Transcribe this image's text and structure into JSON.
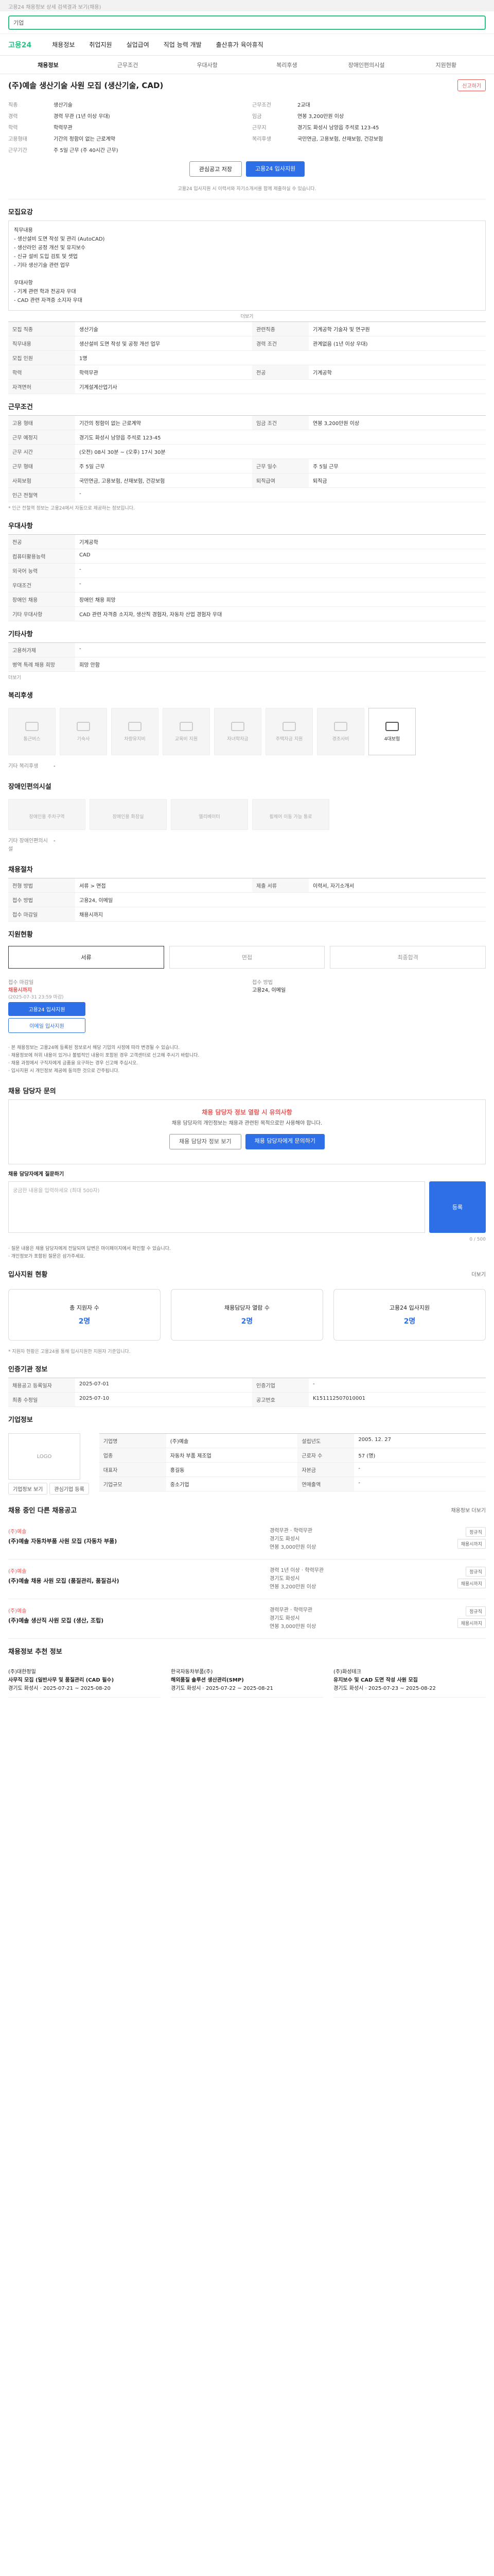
{
  "topbar": {
    "left": "고용24 채용정보 상세 검색결과 보기(채용)",
    "right": ""
  },
  "search": {
    "placeholder": "검색어를 입력하세요",
    "value": "기업"
  },
  "gnb": {
    "logo": "고용24",
    "items": [
      "채용정보",
      "취업지원",
      "실업급여",
      "직업 능력 개발",
      "출산휴가 육아휴직"
    ]
  },
  "tabs": [
    "채용정보",
    "근무조건",
    "우대사항",
    "복리후생",
    "장애인편의시설",
    "지원현황"
  ],
  "header": {
    "title": "(주)예솔 생산기술 사원 모집 (생산기술, CAD)",
    "badge": "채용공고",
    "report": "신고하기"
  },
  "summary": [
    {
      "k": "직종",
      "v": "생산기술"
    },
    {
      "k": "근무조건",
      "v": "2교대"
    },
    {
      "k": "경력",
      "v": "경력 무관 (1년 이상 우대)"
    },
    {
      "k": "임금",
      "v": "연봉 3,200만원 이상"
    },
    {
      "k": "학력",
      "v": "학력무관"
    },
    {
      "k": "근무지",
      "v": "경기도 화성시 남양읍 주석로 123-45"
    },
    {
      "k": "고용형태",
      "v": "기간의 정함이 없는 근로계약"
    },
    {
      "k": "복리후생",
      "v": "국민연금, 고용보험, 산재보험, 건강보험"
    },
    {
      "k": "근무기간",
      "v": "주 5일 근무 (주 40시간 근무)"
    }
  ],
  "buttons": {
    "save": "관심공고 저장",
    "apply": "고용24 입사지원"
  },
  "notice1": "고용24 입사지원 시 이력서와 자기소개서를 함께 제출하실 수 있습니다.",
  "recruit": {
    "title": "모집요강",
    "body": "직무내용\n- 생산설비 도면 작성 및 관리 (AutoCAD)\n- 생산라인 공정 개선 및 유지보수\n- 신규 설비 도입 검토 및 셋업\n- 기타 생산기술 관련 업무\n\n우대사항\n- 기계 관련 학과 전공자 우대\n- CAD 관련 자격증 소지자 우대",
    "more": "더보기",
    "rows": [
      {
        "k": "모집 직종",
        "v": "생산기술",
        "k2": "관련직종",
        "v2": "기계공학 기술자 및 연구원"
      },
      {
        "k": "직무내용",
        "v": "생산설비 도면 작성 및 공정 개선 업무",
        "k2": "경력 조건",
        "v2": "관계없음 (1년 이상 우대)"
      },
      {
        "k": "모집 인원",
        "v": "1명",
        "k2": "",
        "v2": ""
      },
      {
        "k": "학력",
        "v": "학력무관",
        "k2": "전공",
        "v2": "기계공학"
      },
      {
        "k": "자격면허",
        "v": "기계설계산업기사",
        "k2": "",
        "v2": ""
      }
    ]
  },
  "work": {
    "title": "근무조건",
    "rows": [
      {
        "k": "고용 형태",
        "v": "기간의 정함이 없는 근로계약",
        "k2": "임금 조건",
        "v2": "연봉 3,200만원 이상"
      },
      {
        "k": "근무 예정지",
        "v": "경기도 화성시 남양읍 주석로 123-45",
        "k2": "",
        "v2": ""
      },
      {
        "k": "근무 시간",
        "v": "(오전) 08시 30분 ~ (오후) 17시 30분",
        "k2": "",
        "v2": ""
      },
      {
        "k": "근무 형태",
        "v": "주 5일 근무",
        "k2": "근무 일수",
        "v2": "주 5일 근무"
      },
      {
        "k": "사회보험",
        "v": "국민연금, 고용보험, 산재보험, 건강보험",
        "k2": "퇴직급여",
        "v2": "퇴직금"
      },
      {
        "k": "인근 전철역",
        "v": "-",
        "k2": "",
        "v2": ""
      }
    ],
    "note": "* 인근 전철역 정보는 고용24에서 자동으로 제공하는 정보입니다."
  },
  "prefer": {
    "title": "우대사항",
    "rows": [
      {
        "k": "전공",
        "v": "기계공학"
      },
      {
        "k": "컴퓨터활용능력",
        "v": "CAD"
      },
      {
        "k": "외국어 능력",
        "v": "-"
      },
      {
        "k": "우대조건",
        "v": "-"
      },
      {
        "k": "장애인 채용",
        "v": "장애인 채용 희망"
      },
      {
        "k": "기타 우대사항",
        "v": "CAD 관련 자격증 소지자, 생산직 경험자, 자동차 산업 경험자 우대"
      }
    ]
  },
  "etc": {
    "title": "기타사항",
    "rows": [
      {
        "k": "고용허가제",
        "v": "-"
      },
      {
        "k": "병역 특례 채용 희망",
        "v": "희망 안함"
      }
    ],
    "more": "더보기"
  },
  "welfare": {
    "title": "복리후생",
    "items": [
      "통근버스",
      "기숙사",
      "차량유지비",
      "교육비 지원",
      "자녀학자금",
      "주택자금 지원",
      "경조사비",
      "4대보험"
    ],
    "active": "4대보험",
    "etc_label": "기타 복리후생",
    "etc_value": "-"
  },
  "facility": {
    "title": "장애인편의시설",
    "items": [
      "장애인용 주차구역",
      "장애인용 화장실",
      "엘리베이터",
      "휠체어 이동 가능 통로"
    ],
    "etc_label": "기타 장애인편의시설",
    "etc_value": "-"
  },
  "process": {
    "title": "채용절차",
    "rows": [
      {
        "k": "전형 방법",
        "v": "서류 > 면접",
        "k2": "제출 서류",
        "v2": "이력서, 자기소개서"
      },
      {
        "k": "접수 방법",
        "v": "고용24, 이메일",
        "k2": "",
        "v2": ""
      },
      {
        "k": "접수 마감일",
        "v": "채용시까지",
        "k2": "",
        "v2": ""
      }
    ]
  },
  "status": {
    "title": "지원현황",
    "steps": [
      "서류",
      "면접",
      "최종합격"
    ],
    "deadline_label": "접수 마감일",
    "deadline": "채용시까지",
    "deadline_sub": "(2025-07-31 23:59 마감)",
    "contact_label": "접수 방법",
    "contact": "고용24, 이메일",
    "btn1": "고용24 입사지원",
    "btn2": "이메일 입사지원"
  },
  "bullets": [
    "· 본 채용정보는 고용24에 등록된 정보로서 해당 기업의 사정에 따라 변경될 수 있습니다.",
    "· 채용정보에 허위 내용이 있거나 불법적인 내용이 포함된 경우 고객센터로 신고해 주시기 바랍니다.",
    "· 채용 과정에서 구직자에게 금품을 요구하는 경우 신고해 주십시오.",
    "· 입사지원 시 개인정보 제공에 동의한 것으로 간주됩니다."
  ],
  "qa": {
    "title": "채용 담당자 문의",
    "warn": "채용 담당자 정보 열람 시 유의사항",
    "desc": "채용 담당자의 개인정보는 채용과 관련된 목적으로만 사용해야 합니다.",
    "btn1": "채용 담당자 정보 보기",
    "btn2": "채용 담당자에게 문의하기",
    "input_label": "채용 담당자에게 질문하기",
    "placeholder": "궁금한 내용을 입력하세요 (최대 500자)",
    "counter": "0 / 500",
    "submit": "등록",
    "notes": [
      "· 질문 내용은 채용 담당자에게 전달되며 답변은 마이페이지에서 확인할 수 있습니다.",
      "· 개인정보가 포함된 질문은 삼가주세요."
    ]
  },
  "applicants": {
    "title": "입사지원 현황",
    "more": "더보기",
    "cards": [
      {
        "label": "총 지원자 수",
        "value": "2명"
      },
      {
        "label": "채용담당자 열람 수",
        "value": "2명"
      },
      {
        "label": "고용24 입사지원",
        "value": "2명"
      }
    ],
    "note": "* 지원자 현황은 고용24를 통해 입사지원한 지원자 기준입니다."
  },
  "consult": {
    "title": "인증기관 정보",
    "rows": [
      {
        "k": "채용공고 등록일자",
        "v": "2025-07-01",
        "k2": "인증기업",
        "v2": "-"
      },
      {
        "k": "최종 수정일",
        "v": "2025-07-10",
        "k2": "공고번호",
        "v2": "K151112507010001"
      }
    ]
  },
  "company": {
    "title": "기업정보",
    "logo": "LOGO",
    "info_btn": "기업정보 보기",
    "follow_btn": "관심기업 등록",
    "rows": [
      {
        "k": "기업명",
        "v": "(주)예솔",
        "k2": "설립년도",
        "v2": "2005. 12. 27"
      },
      {
        "k": "업종",
        "v": "자동차 부품 제조업",
        "k2": "근로자 수",
        "v2": "57 (명)"
      },
      {
        "k": "대표자",
        "v": "홍길동",
        "k2": "자본금",
        "v2": "-"
      },
      {
        "k": "기업규모",
        "v": "중소기업",
        "k2": "연매출액",
        "v2": "-"
      }
    ]
  },
  "others": {
    "title": "채용 중인 다른 채용공고",
    "more": "채용정보 더보기",
    "items": [
      {
        "co": "(주)예솔",
        "title": "(주)예솔 자동차부품 사원 모집 (자동차 부품)",
        "info1": "경력무관 · 학력무관",
        "info2": "경기도 화성시",
        "info3": "연봉 3,000만원 이상",
        "tag1": "정규직",
        "tag2": "채용시까지"
      },
      {
        "co": "(주)예솔",
        "title": "(주)예솔 채용 사원 모집 (품질관리, 품질검사)",
        "info1": "경력 1년 이상 · 학력무관",
        "info2": "경기도 화성시",
        "info3": "연봉 3,200만원 이상",
        "tag1": "정규직",
        "tag2": "채용시까지"
      },
      {
        "co": "(주)예솔",
        "title": "(주)예솔 생산직 사원 모집 (생산, 조립)",
        "info1": "경력무관 · 학력무관",
        "info2": "경기도 화성시",
        "info3": "연봉 3,000만원 이상",
        "tag1": "정규직",
        "tag2": "채용시까지"
      }
    ]
  },
  "recommend": {
    "title": "채용정보 추천 정보",
    "items": [
      {
        "co": "(주)대한정밀",
        "title": "사무직 모집 (일반사무 및 품질관리 (CAD 필수)",
        "info": "경기도 화성시 · 2025-07-21 ~ 2025-08-20"
      },
      {
        "co": "한국자동차부품(주)",
        "title": "해외품질 솔루션 생산관리(SMP)",
        "info": "경기도 화성시 · 2025-07-22 ~ 2025-08-21"
      },
      {
        "co": "(주)화성테크",
        "title": "유지보수 및 CAD 도면 작성 사원 모집",
        "info": "경기도 화성시 · 2025-07-23 ~ 2025-08-22"
      }
    ]
  }
}
